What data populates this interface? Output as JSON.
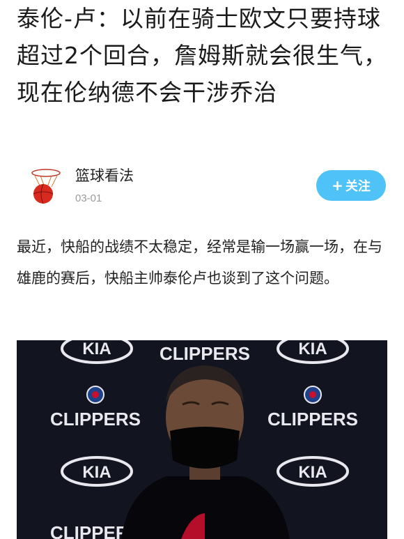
{
  "article": {
    "title": "泰伦-卢：以前在骑士欧文只要持球超过2个回合，詹姆斯就会很生气，现在伦纳德不会干涉乔治",
    "author": "篮球看法",
    "date": "03-01",
    "follow_label": "关注",
    "follow_icon": "plus-icon",
    "paragraph": "最近，快船的战绩不太稳定，经常是输一场赢一场，在与雄鹿的赛后，快船主帅泰伦卢也谈到了这个问题。"
  },
  "photo": {
    "backdrop_logos": [
      "KIA",
      "CLIPPERS"
    ],
    "colors": {
      "backdrop": "#12141f",
      "logo": "#e8e8ee",
      "accent_red": "#c8102e",
      "accent_blue": "#1d428a"
    }
  },
  "colors": {
    "follow_button": "#4fc3f7",
    "text": "#1a1a1a",
    "meta": "#9a9a9a"
  }
}
